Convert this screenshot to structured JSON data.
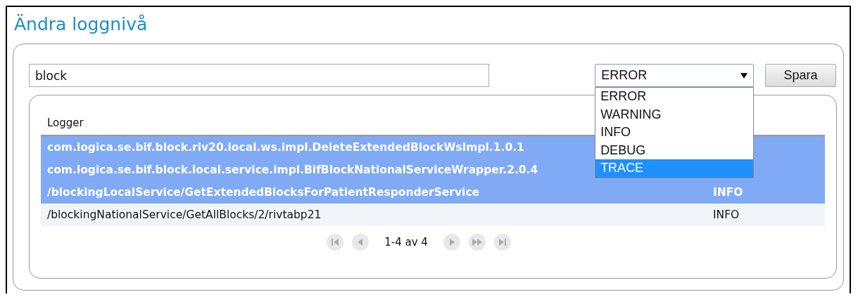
{
  "title": "Ändra loggnivå",
  "search": {
    "value": "block"
  },
  "level_select": {
    "value": "ERROR",
    "expanded": true,
    "options": [
      {
        "label": "ERROR",
        "highlighted": false
      },
      {
        "label": "WARNING",
        "highlighted": false
      },
      {
        "label": "INFO",
        "highlighted": false
      },
      {
        "label": "DEBUG",
        "highlighted": false
      },
      {
        "label": "TRACE",
        "highlighted": true
      }
    ]
  },
  "save_button": "Spara",
  "table": {
    "columns": [
      "Logger"
    ],
    "rows": [
      {
        "logger": "com.logica.se.bif.block.riv20.local.ws.impl.DeleteExtendedBlockWsImpl.1.0.1",
        "selected": true
      },
      {
        "logger": "com.logica.se.bif.block.local.service.impl.BifBlockNationalServiceWrapper.2.0.4",
        "selected": true
      },
      {
        "logger": "/blockingLocalService/GetExtendedBlocksForPatientResponderService",
        "level": "INFO",
        "selected": true
      },
      {
        "logger": "/blockingNationalService/GetAllBlocks/2/rivtabp21",
        "level": "INFO",
        "selected": false
      }
    ]
  },
  "pager": {
    "text": "1-4 av 4"
  }
}
